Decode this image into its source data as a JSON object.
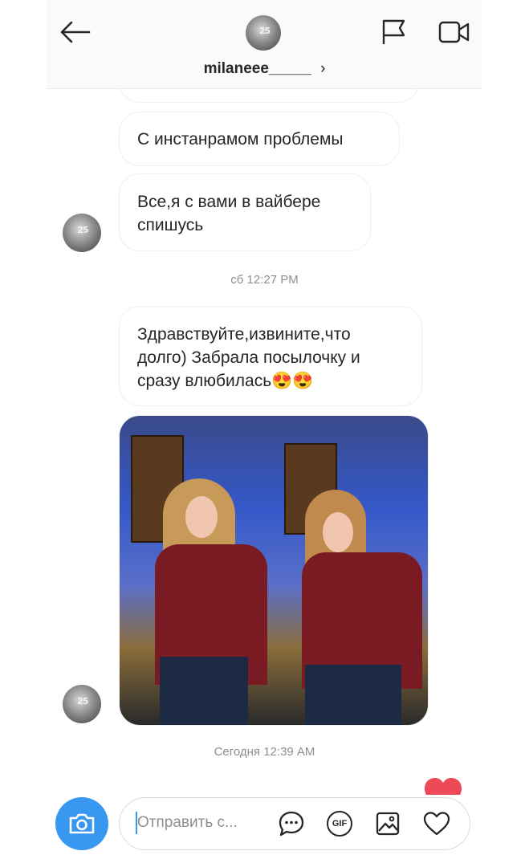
{
  "header": {
    "username": "milaneee_____",
    "chevron": "›",
    "avatar_text": "25"
  },
  "messages": [
    {
      "text": "С инстанрамом проблемы"
    },
    {
      "text_line1": "Все,я с вами в вайбере",
      "text_line2": "спишусь"
    },
    {
      "text_line1": "Здравствуйте,извините,что",
      "text_line2": "долго) Забрала посылочку и",
      "text_line3": "сразу влюбилась😍😍"
    }
  ],
  "timestamps": {
    "first": "сб 12:27 PM",
    "second": "Сегодня 12:39 AM"
  },
  "composer": {
    "placeholder": "Отправить с...",
    "gif_label": "GIF"
  },
  "icons": {
    "back": "back-arrow-icon",
    "flag": "flag-icon",
    "video": "video-call-icon",
    "camera": "camera-icon",
    "chat": "chat-bubble-icon",
    "gif": "gif-icon",
    "gallery": "gallery-icon",
    "heart": "heart-icon"
  },
  "colors": {
    "accent_blue": "#3897f0",
    "bubble_border": "#efefef",
    "muted_text": "#8e8e8e",
    "heart_red": "#ed4956"
  }
}
